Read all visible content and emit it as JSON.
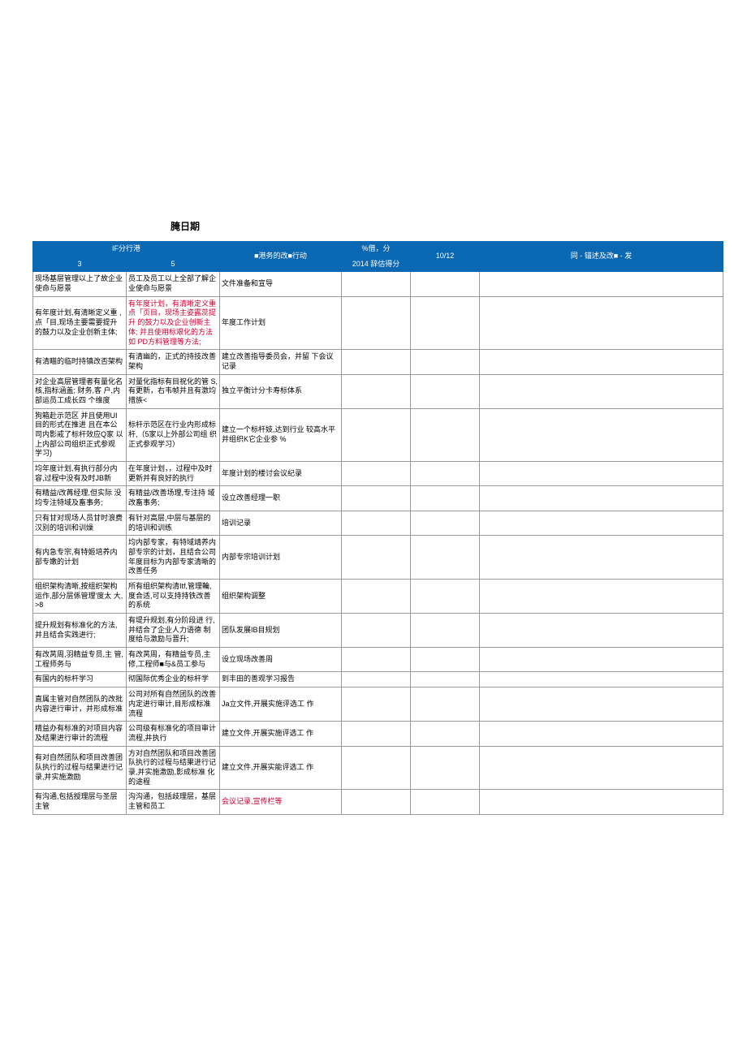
{
  "title_date": "腌日期",
  "header": {
    "col_group_left": "IF分行港",
    "col_3": "3",
    "col_5": "5",
    "col_action": "■港务的改■行动",
    "col_pct": "%借，分",
    "col_score_2014": "2014 辞估得分",
    "col_10_12": "10/12",
    "col_desc": "同 - 锚述及改■ - 发"
  },
  "rows": [
    {
      "c3": "现场基层管理以上了故企业使命与愿景",
      "c5": "员工及员工以上全部了解企 业使命与愿景",
      "action": "文件准备和宣导",
      "red": false
    },
    {
      "c3": "有年度计划,有清晰定义重 ,点「目,现场主要需要提升    的鼓力以及企业创新主体;",
      "c5": "有年度计划，有清晰定义重 点「页目，现场主姿露蕊提升 的鼓力以及企业创新主体;    并且使用标艰化的方法如   PD方料管理等方法;",
      "action": "年度工作计划",
      "red": true
    },
    {
      "c3": "有清瞄的临时持镇改否架构",
      "c5": "有清幽的，正式的持技改善 架构",
      "action": "建立改善指导委员会，并留 下会议记录",
      "red": false
    },
    {
      "c3": "对企业高层管理者有量化名 核,指标涵盖; 财务,客 户,内部运员工成长四 个维度",
      "c5": "对量化指标有目祝化的管 S,有更新，右韦帧并且有激均措族<",
      "action": "独立平衡计分卡寿标体系",
      "red": false
    },
    {
      "c3": "狗箱赴示范区 并且使用UI  目的形式在推进 且在本公 司内影戒了标杆效应Q家 以上内部公司组织正式参观 学习)",
      "c5": "标杆示范区在行业内形成标 杆,（5家以上外部公司组 织正式参观学习）",
      "action": "建立一个标杆妓,达到行业   较高水平并组织K它企业参 %",
      "red": false
    },
    {
      "c3": "均年度计划,有执行部分内 容,过程中没有及时JB新",
      "c5": "在年度计划，，过程中及时 更新并有良好的执行",
      "action": "年度计划的楼讨会议纪录",
      "red": false
    },
    {
      "c3": "有精益/改苒经理,但实际 没均专注特域及畜事务;",
      "c5": "有精益/改善场理,专注持 域改畜事务;",
      "action": "设立改善经理一职",
      "red": false
    },
    {
      "c3": "只有甘对现场人员甘时浪费汉别的培训和训燥",
      "c5": "有针对高层,中层与基层的 的培训和训练",
      "action": "培训记录",
      "red": false
    },
    {
      "c3": "有内急专宗,有特姬培养内   部专嫩的计划",
      "c5": "均内部专家，有特域靖养内 部专宗的计划，且结合公司 年度目标为内部专家清晰的 改善任务",
      "action": "内部专宗培训计划",
      "red": false
    },
    {
      "c3": "组织架构清晰,按组织架构 运作,部分层係管理'度太 大, >8",
      "c5": "所有组织架构清Itf,管理輪,度合适,可以支持持铁改善 的系统",
      "action": "组织架构调整",
      "red": false
    },
    {
      "c3": "提升规划有标准化的方法,并且结合实践进行;",
      "c5": "有堤升规划,有分阶段进 行,并结合了企业人力语德 制度给与激励与晋升;",
      "action": "团队发展IB目规划",
      "red": false
    },
    {
      "c3": "有改莴周,羽精益专员,主 管,工程师务与",
      "c5": "有改莴周，有精益专员,主 修,工程师■与&员工参与",
      "action": "设立现场改善周",
      "red": false
    },
    {
      "c3": "有国内的标杆学习",
      "c5": "彻国际优秀企业的标杆学",
      "action": "到丰田的善观学习报告",
      "red": false
    },
    {
      "c3": "直属主管对自然团队的改批内容进行审计，并形成标准",
      "c5": "公司对所有自然团队的改善 内定进行审计,目形成标准 流程",
      "action": "Ja立文件,开展实施评选工 作",
      "red": false
    },
    {
      "c3": "精益办有标准的对项目内容及结果进行审计的流程",
      "c5": "公司级有标准化的项目审计 流程,井执行",
      "action": "建立文件,开展实施评选工 作",
      "red": false
    },
    {
      "c3": "有对自然团队和项目改善团队执行的过程与结果进行记录,并实施激励",
      "c5": "方对自然团队和项目改善团 队执行的过程与结果进行记 录,并实施激励,影成标准 化的途程",
      "action": "建立文件,开展实能评选工 作",
      "red": false
    },
    {
      "c3": "有沟通,包括授理层与圣层   主管",
      "c5": "沟沟通，包括歧理层，基层 主管和员工",
      "action": "会议记录,宣传栏等",
      "action_red": true
    }
  ]
}
